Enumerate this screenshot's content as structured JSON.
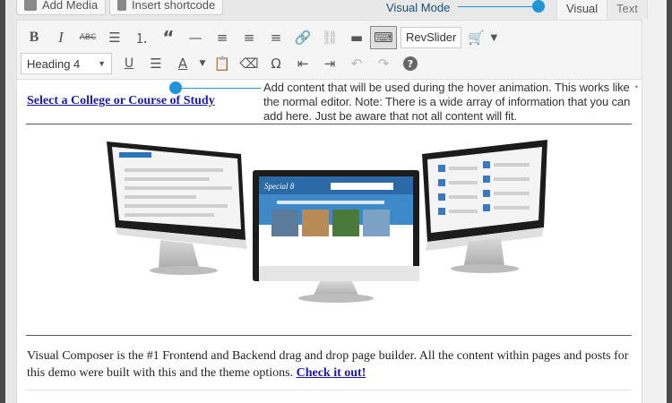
{
  "toolbar_top": {
    "add_media_label": "Add Media",
    "insert_shortcode_label": "Insert shortcode",
    "visual_mode_label": "Visual Mode"
  },
  "tabs": [
    {
      "label": "Visual",
      "active": true
    },
    {
      "label": "Text",
      "active": false
    }
  ],
  "toolbar": {
    "row1": [
      "bold",
      "italic",
      "strikethrough",
      "bulleted-list",
      "numbered-list",
      "blockquote",
      "horizontal-line",
      "align-left",
      "align-center",
      "align-right",
      "insert-link",
      "remove-link",
      "read-more",
      "toolbar-toggle"
    ],
    "revslider_label": "RevSlider",
    "row2_format_value": "Heading 4",
    "row2": [
      "underline",
      "justify",
      "text-color",
      "paste-as-text",
      "clear-formatting",
      "special-character",
      "outdent",
      "indent",
      "undo",
      "redo",
      "help"
    ]
  },
  "content": {
    "heading_link": "Select a College or Course of Study",
    "hover_note": "Add content that will be used during the hover animation. This  works like the normal editor. Note: There is a wide array of information that you can add here. Just be aware that not all content will fit.",
    "body_text": "Visual Composer is the #1 Frontend and Backend drag and drop page builder. All the content within pages and posts for this demo were built with this and the theme options.",
    "body_link": "Check it out!",
    "screen_title": "Special 8"
  },
  "colors": {
    "callout": "#1f95d6",
    "link": "#1a1aa6",
    "frame": "#4a4a4a"
  }
}
